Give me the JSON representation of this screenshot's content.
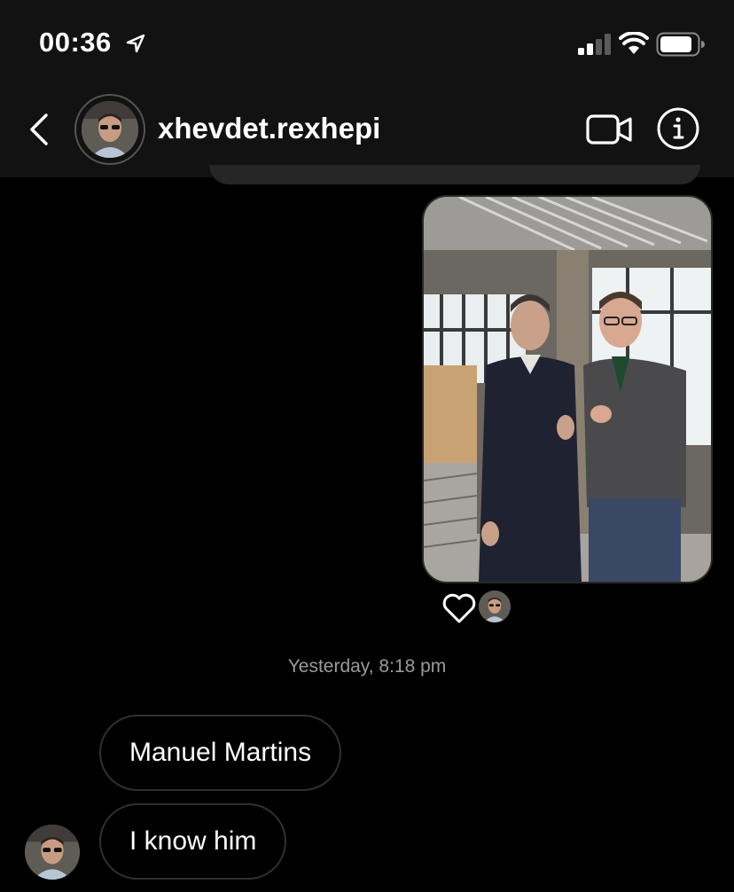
{
  "status_bar": {
    "time": "00:36",
    "icons": [
      "location-arrow-icon",
      "cellular-signal-icon",
      "wifi-icon",
      "battery-icon"
    ]
  },
  "header": {
    "username": "xhevdet.rexhepi",
    "icons": [
      "back-chevron-icon",
      "video-call-icon",
      "info-icon"
    ]
  },
  "thread": {
    "reaction_icon": "heart-icon",
    "timestamp": "Yesterday, 8:18 pm",
    "messages": [
      {
        "text": "Manuel Martins"
      },
      {
        "text": "I know him"
      }
    ]
  },
  "colors": {
    "background": "#000000",
    "bar": "#121212",
    "bubble_border": "#303030",
    "timestamp": "#9a9a9a"
  }
}
